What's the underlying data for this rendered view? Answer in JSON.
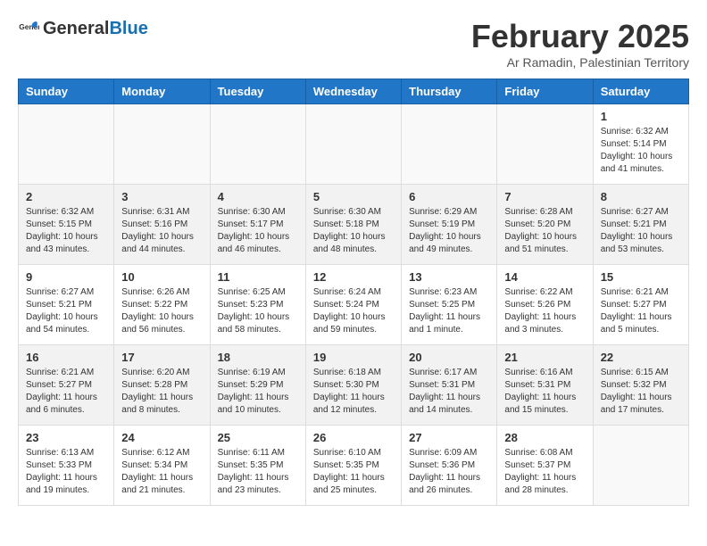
{
  "logo": {
    "general": "General",
    "blue": "Blue"
  },
  "header": {
    "month": "February 2025",
    "location": "Ar Ramadin, Palestinian Territory"
  },
  "weekdays": [
    "Sunday",
    "Monday",
    "Tuesday",
    "Wednesday",
    "Thursday",
    "Friday",
    "Saturday"
  ],
  "weeks": [
    [
      {
        "day": "",
        "info": ""
      },
      {
        "day": "",
        "info": ""
      },
      {
        "day": "",
        "info": ""
      },
      {
        "day": "",
        "info": ""
      },
      {
        "day": "",
        "info": ""
      },
      {
        "day": "",
        "info": ""
      },
      {
        "day": "1",
        "info": "Sunrise: 6:32 AM\nSunset: 5:14 PM\nDaylight: 10 hours and 41 minutes."
      }
    ],
    [
      {
        "day": "2",
        "info": "Sunrise: 6:32 AM\nSunset: 5:15 PM\nDaylight: 10 hours and 43 minutes."
      },
      {
        "day": "3",
        "info": "Sunrise: 6:31 AM\nSunset: 5:16 PM\nDaylight: 10 hours and 44 minutes."
      },
      {
        "day": "4",
        "info": "Sunrise: 6:30 AM\nSunset: 5:17 PM\nDaylight: 10 hours and 46 minutes."
      },
      {
        "day": "5",
        "info": "Sunrise: 6:30 AM\nSunset: 5:18 PM\nDaylight: 10 hours and 48 minutes."
      },
      {
        "day": "6",
        "info": "Sunrise: 6:29 AM\nSunset: 5:19 PM\nDaylight: 10 hours and 49 minutes."
      },
      {
        "day": "7",
        "info": "Sunrise: 6:28 AM\nSunset: 5:20 PM\nDaylight: 10 hours and 51 minutes."
      },
      {
        "day": "8",
        "info": "Sunrise: 6:27 AM\nSunset: 5:21 PM\nDaylight: 10 hours and 53 minutes."
      }
    ],
    [
      {
        "day": "9",
        "info": "Sunrise: 6:27 AM\nSunset: 5:21 PM\nDaylight: 10 hours and 54 minutes."
      },
      {
        "day": "10",
        "info": "Sunrise: 6:26 AM\nSunset: 5:22 PM\nDaylight: 10 hours and 56 minutes."
      },
      {
        "day": "11",
        "info": "Sunrise: 6:25 AM\nSunset: 5:23 PM\nDaylight: 10 hours and 58 minutes."
      },
      {
        "day": "12",
        "info": "Sunrise: 6:24 AM\nSunset: 5:24 PM\nDaylight: 10 hours and 59 minutes."
      },
      {
        "day": "13",
        "info": "Sunrise: 6:23 AM\nSunset: 5:25 PM\nDaylight: 11 hours and 1 minute."
      },
      {
        "day": "14",
        "info": "Sunrise: 6:22 AM\nSunset: 5:26 PM\nDaylight: 11 hours and 3 minutes."
      },
      {
        "day": "15",
        "info": "Sunrise: 6:21 AM\nSunset: 5:27 PM\nDaylight: 11 hours and 5 minutes."
      }
    ],
    [
      {
        "day": "16",
        "info": "Sunrise: 6:21 AM\nSunset: 5:27 PM\nDaylight: 11 hours and 6 minutes."
      },
      {
        "day": "17",
        "info": "Sunrise: 6:20 AM\nSunset: 5:28 PM\nDaylight: 11 hours and 8 minutes."
      },
      {
        "day": "18",
        "info": "Sunrise: 6:19 AM\nSunset: 5:29 PM\nDaylight: 11 hours and 10 minutes."
      },
      {
        "day": "19",
        "info": "Sunrise: 6:18 AM\nSunset: 5:30 PM\nDaylight: 11 hours and 12 minutes."
      },
      {
        "day": "20",
        "info": "Sunrise: 6:17 AM\nSunset: 5:31 PM\nDaylight: 11 hours and 14 minutes."
      },
      {
        "day": "21",
        "info": "Sunrise: 6:16 AM\nSunset: 5:31 PM\nDaylight: 11 hours and 15 minutes."
      },
      {
        "day": "22",
        "info": "Sunrise: 6:15 AM\nSunset: 5:32 PM\nDaylight: 11 hours and 17 minutes."
      }
    ],
    [
      {
        "day": "23",
        "info": "Sunrise: 6:13 AM\nSunset: 5:33 PM\nDaylight: 11 hours and 19 minutes."
      },
      {
        "day": "24",
        "info": "Sunrise: 6:12 AM\nSunset: 5:34 PM\nDaylight: 11 hours and 21 minutes."
      },
      {
        "day": "25",
        "info": "Sunrise: 6:11 AM\nSunset: 5:35 PM\nDaylight: 11 hours and 23 minutes."
      },
      {
        "day": "26",
        "info": "Sunrise: 6:10 AM\nSunset: 5:35 PM\nDaylight: 11 hours and 25 minutes."
      },
      {
        "day": "27",
        "info": "Sunrise: 6:09 AM\nSunset: 5:36 PM\nDaylight: 11 hours and 26 minutes."
      },
      {
        "day": "28",
        "info": "Sunrise: 6:08 AM\nSunset: 5:37 PM\nDaylight: 11 hours and 28 minutes."
      },
      {
        "day": "",
        "info": ""
      }
    ]
  ]
}
